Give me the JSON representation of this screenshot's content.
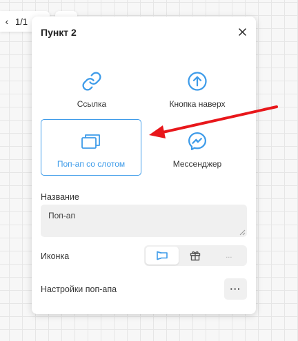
{
  "pager": {
    "count": "1/1"
  },
  "panel": {
    "title": "Пункт 2",
    "options": [
      {
        "label": "Ссылка",
        "icon": "link-icon"
      },
      {
        "label": "Кнопка наверх",
        "icon": "arrow-up-circle-icon"
      },
      {
        "label": "Поп-ап со слотом",
        "icon": "popup-window-icon",
        "selected": true
      },
      {
        "label": "Мессенджер",
        "icon": "messenger-icon"
      }
    ],
    "name": {
      "label": "Название",
      "value": "Поп-ап"
    },
    "icon_field": {
      "label": "Иконка",
      "options": [
        "megaphone-icon",
        "gift-icon",
        "..."
      ],
      "selected": "megaphone-icon"
    },
    "popup_settings": {
      "label": "Настройки поп-апа",
      "button": "···"
    }
  },
  "colors": {
    "accent": "#3d9be9",
    "arrow": "#e8171b"
  }
}
